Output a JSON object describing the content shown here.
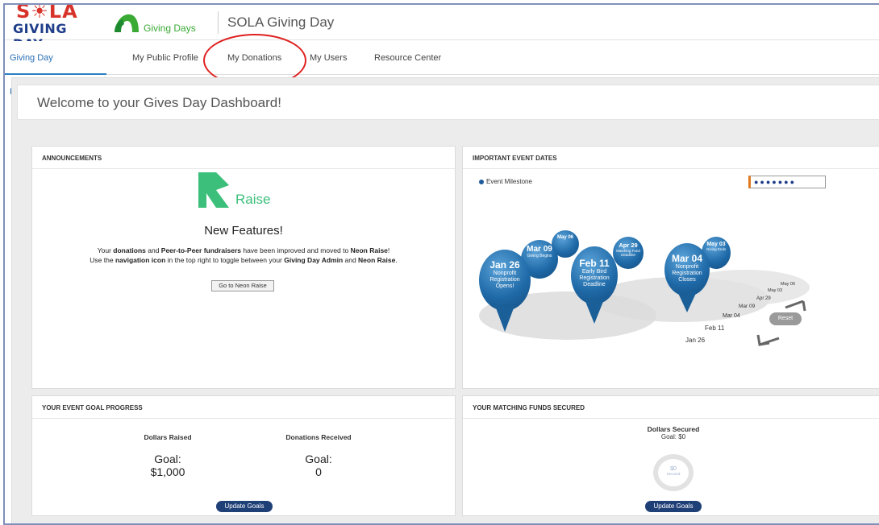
{
  "header": {
    "logo_line1": "S☀LA",
    "logo_line2": "GIVING DAY",
    "giving_days_label": "Giving Days",
    "app_title": "SOLA Giving Day"
  },
  "tabs": [
    {
      "label": "Giving Day Performance",
      "active": true
    },
    {
      "label": "My Public Profile"
    },
    {
      "label": "My Donations"
    },
    {
      "label": "My Users"
    },
    {
      "label": "Resource Center"
    }
  ],
  "welcome": "Welcome to your Gives Day Dashboard!",
  "announcements": {
    "title": "ANNOUNCEMENTS",
    "raise_word": "Raise",
    "heading": "New Features!",
    "line1_a": "Your ",
    "line1_b": "donations",
    "line1_c": " and ",
    "line1_d": "Peer-to-Peer fundraisers",
    "line1_e": " have been improved and moved to ",
    "line1_f": "Neon Raise",
    "line1_g": "!",
    "line2_a": "Use the ",
    "line2_b": "navigation icon",
    "line2_c": " in the top right to toggle between your ",
    "line2_d": "Giving Day Admin",
    "line2_e": " and ",
    "line2_f": "Neon Raise",
    "line2_g": ".",
    "button": "Go to Neon Raise"
  },
  "event_dates": {
    "title": "IMPORTANT EVENT DATES",
    "legend": "Event Milestone",
    "nav_dots": "●●●●●●●",
    "reset": "Reset",
    "pins": [
      {
        "date": "Jan 26",
        "label": "Nonprofit Registration Opens!"
      },
      {
        "date": "Mar 09",
        "label": "Giving Begins"
      },
      {
        "date": "May 06",
        "label": ""
      },
      {
        "date": "Feb 11",
        "label": "Early Bird Registration Deadline"
      },
      {
        "date": "Apr 29",
        "label": "Matching Fund Deadline"
      },
      {
        "date": "Mar 04",
        "label": "Nonprofit Registration Closes"
      },
      {
        "date": "May 03",
        "label": "Giving Ends"
      }
    ],
    "axis": [
      "Jan 26",
      "Feb 11",
      "Mar 04",
      "Mar 09",
      "Apr 29",
      "May 03",
      "May 06"
    ]
  },
  "goal_progress": {
    "title": "YOUR EVENT GOAL PROGRESS",
    "dollars_head": "Dollars Raised",
    "dollars_goal_label": "Goal:",
    "dollars_goal_value": "$1,000",
    "donations_head": "Donations Received",
    "donations_goal_label": "Goal:",
    "donations_goal_value": "0",
    "button": "Update Goals"
  },
  "matching": {
    "title": "YOUR MATCHING FUNDS SECURED",
    "head": "Dollars Secured",
    "goal": "Goal: $0",
    "ring_value": "$0",
    "ring_label": "Secured",
    "button": "Update Goals"
  }
}
